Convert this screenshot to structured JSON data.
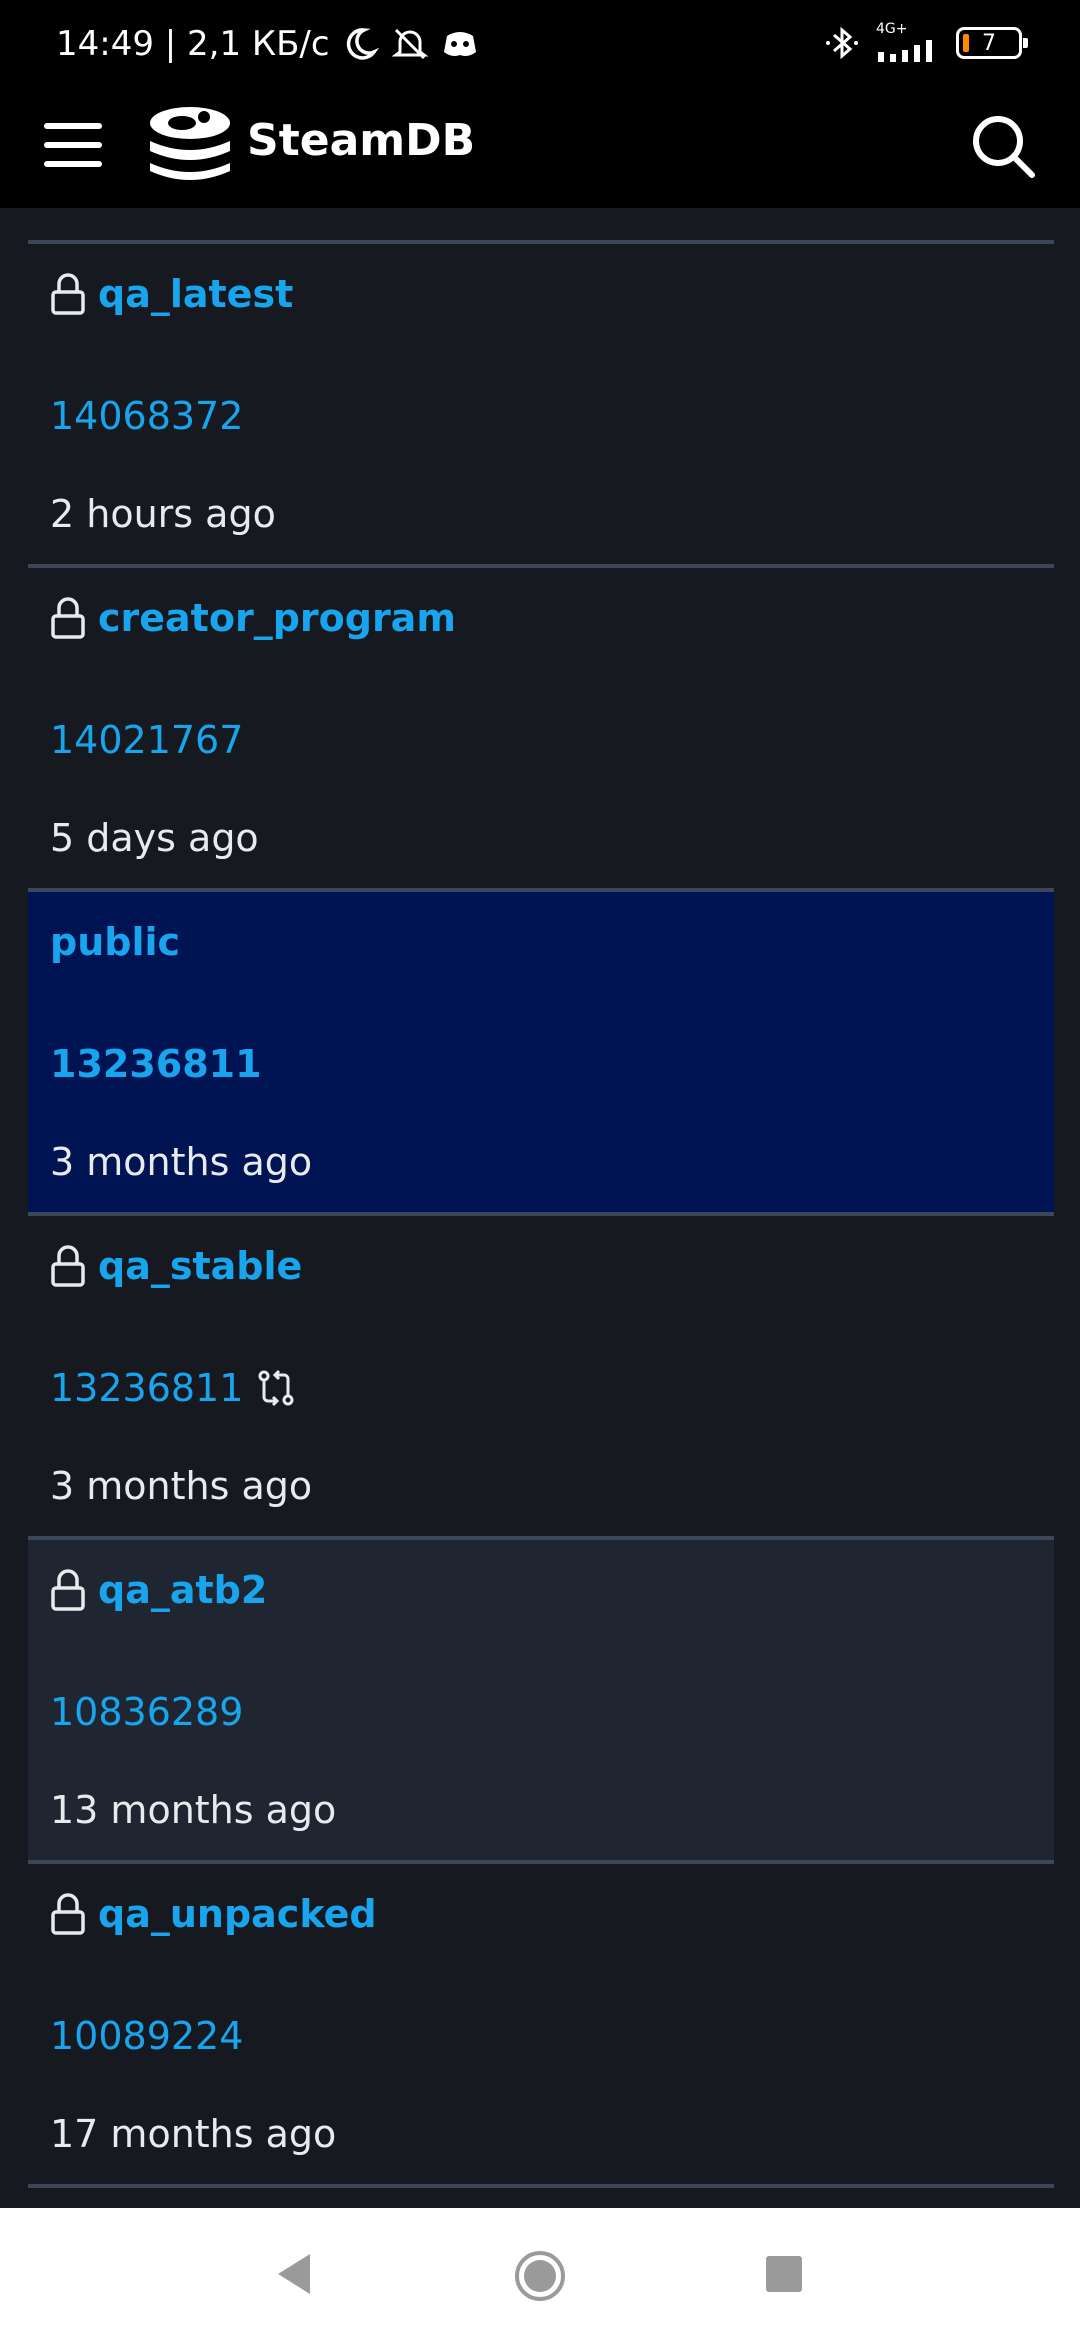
{
  "status_bar": {
    "time_and_speed": "14:49 | 2,1 КБ/с",
    "network_label": "4G+",
    "battery_level": "7",
    "icons": [
      "moon-icon",
      "bell-off-icon",
      "discord-icon",
      "bluetooth-icon",
      "signal-icon",
      "battery-icon"
    ]
  },
  "header": {
    "brand": "SteamDB",
    "icons": [
      "menu-icon",
      "steamdb-logo",
      "search-icon"
    ]
  },
  "branches": [
    {
      "name": "qa_latest",
      "build": "14068372",
      "time": "2 hours ago",
      "locked": true
    },
    {
      "name": "creator_program",
      "build": "14021767",
      "time": "5 days ago",
      "locked": true
    },
    {
      "name": "public",
      "build": "13236811",
      "time": "3 months ago",
      "locked": false,
      "highlighted": true
    },
    {
      "name": "qa_stable",
      "build": "13236811",
      "time": "3 months ago",
      "locked": true,
      "same_as_public": true
    },
    {
      "name": "qa_atb2",
      "build": "10836289",
      "time": "13 months ago",
      "locked": true
    },
    {
      "name": "qa_unpacked",
      "build": "10089224",
      "time": "17 months ago",
      "locked": true
    }
  ],
  "colors": {
    "accent": "#19a5ed",
    "background": "#161920",
    "highlight_row": "#001352",
    "divider": "#3b4659"
  },
  "nav": {
    "icons": [
      "back-icon",
      "home-icon",
      "recents-icon"
    ]
  }
}
